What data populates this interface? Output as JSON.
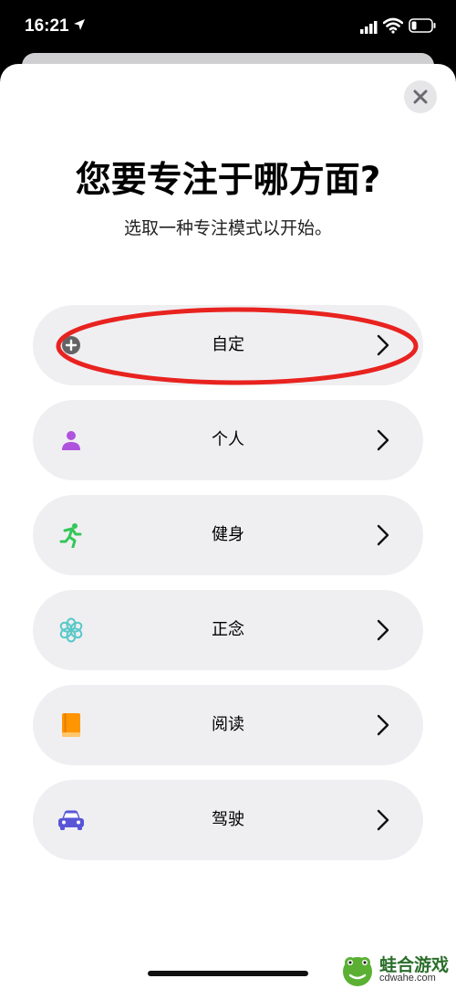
{
  "status_bar": {
    "time": "16:21"
  },
  "dialog": {
    "title": "您要专注于哪方面?",
    "subtitle": "选取一种专注模式以开始。",
    "close_icon": "close-icon"
  },
  "options": [
    {
      "label": "自定",
      "icon": "plus-circle-icon",
      "color": "#636366",
      "highlighted": true
    },
    {
      "label": "个人",
      "icon": "person-icon",
      "color": "#af52de"
    },
    {
      "label": "健身",
      "icon": "running-figure-icon",
      "color": "#34c759"
    },
    {
      "label": "正念",
      "icon": "flower-icon",
      "color": "#5ac8c8"
    },
    {
      "label": "阅读",
      "icon": "book-icon",
      "color": "#ff9500"
    },
    {
      "label": "驾驶",
      "icon": "car-icon",
      "color": "#5856d6"
    }
  ],
  "annotation": {
    "color": "#e8231f"
  },
  "watermark": {
    "name": "蛙合游戏",
    "url": "cdwahe.com"
  }
}
